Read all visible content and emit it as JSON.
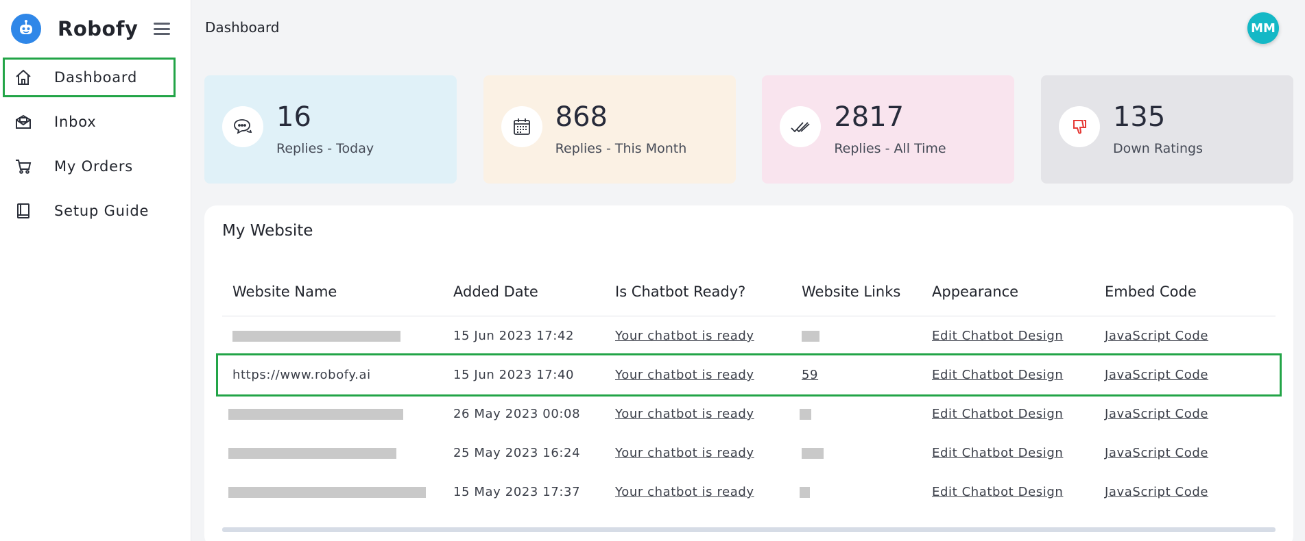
{
  "brand": {
    "name": "Robofy"
  },
  "sidebar": {
    "items": [
      {
        "label": "Dashboard",
        "icon": "home-icon",
        "active": true
      },
      {
        "label": "Inbox",
        "icon": "inbox-icon",
        "active": false
      },
      {
        "label": "My Orders",
        "icon": "cart-icon",
        "active": false
      },
      {
        "label": "Setup Guide",
        "icon": "book-icon",
        "active": false
      }
    ]
  },
  "header": {
    "title": "Dashboard",
    "avatar_initials": "MM"
  },
  "stats": [
    {
      "value": "16",
      "label": "Replies - Today",
      "icon": "chat-bubbles-icon",
      "bg": "#e0f1f8"
    },
    {
      "value": "868",
      "label": "Replies - This Month",
      "icon": "calendar-icon",
      "bg": "#fbf1e4"
    },
    {
      "value": "2817",
      "label": "Replies - All Time",
      "icon": "double-check-icon",
      "bg": "#f9e4ee"
    },
    {
      "value": "135",
      "label": "Down Ratings",
      "icon": "thumbs-down-icon",
      "bg": "#e4e4e8"
    }
  ],
  "websites": {
    "title": "My Website",
    "columns": [
      "Website Name",
      "Added Date",
      "Is Chatbot Ready?",
      "Website Links",
      "Appearance",
      "Embed Code"
    ],
    "rows": [
      {
        "name": "",
        "date": "15 Jun 2023 17:42",
        "ready": "Your chatbot is ready",
        "links": "",
        "appearance": "Edit Chatbot Design",
        "embed": "JavaScript Code"
      },
      {
        "name": "https://www.robofy.ai",
        "date": "15 Jun 2023 17:40",
        "ready": "Your chatbot is ready",
        "links": "59",
        "appearance": "Edit Chatbot Design",
        "embed": "JavaScript Code"
      },
      {
        "name": "",
        "date": "26 May 2023 00:08",
        "ready": "Your chatbot is ready",
        "links": "",
        "appearance": "Edit Chatbot Design",
        "embed": "JavaScript Code"
      },
      {
        "name": "",
        "date": "25 May 2023 16:24",
        "ready": "Your chatbot is ready",
        "links": "",
        "appearance": "Edit Chatbot Design",
        "embed": "JavaScript Code"
      },
      {
        "name": "",
        "date": "15 May 2023 17:37",
        "ready": "Your chatbot is ready",
        "links": "",
        "appearance": "Edit Chatbot Design",
        "embed": "JavaScript Code"
      }
    ]
  },
  "colors": {
    "brand": "#2f87e8",
    "highlight": "#22a447",
    "avatar": "#14b8c6",
    "down_rating_icon": "#e53935"
  }
}
